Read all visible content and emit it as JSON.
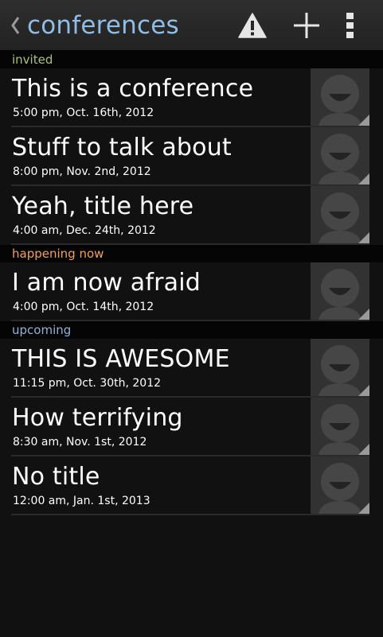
{
  "app_bar": {
    "title": "conferences",
    "actions": {
      "warning_icon": "warning-triangle-icon",
      "add_icon": "plus-icon",
      "overflow_icon": "vertical-dots-icon"
    }
  },
  "colors": {
    "title": "#8fbde8",
    "invited": "#a9c27f",
    "happening_now": "#f0a05a",
    "upcoming": "#8fb3d9",
    "background": "#111111"
  },
  "sections": {
    "invited": {
      "header": "invited",
      "items": [
        {
          "title": "This is a conference",
          "time": "5:00 pm, Oct. 16th, 2012"
        },
        {
          "title": "Stuff to talk about",
          "time": "8:00 pm, Nov. 2nd, 2012"
        },
        {
          "title": "Yeah, title here",
          "time": "4:00 am, Dec. 24th, 2012"
        }
      ]
    },
    "now": {
      "header": "happening now",
      "items": [
        {
          "title": "I am now afraid",
          "time": "4:00 pm, Oct. 14th, 2012"
        }
      ]
    },
    "upcoming": {
      "header": "upcoming",
      "items": [
        {
          "title": "THIS IS AWESOME",
          "time": "11:15 pm, Oct. 30th, 2012"
        },
        {
          "title": "How terrifying",
          "time": "8:30 am, Nov. 1st, 2012"
        },
        {
          "title": "No title",
          "time": "12:00 am, Jan. 1st, 2013"
        }
      ]
    }
  }
}
